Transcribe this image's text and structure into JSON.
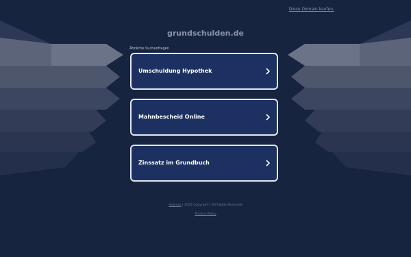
{
  "header": {
    "buy_domain_link": "Diese Domain kaufen."
  },
  "domain": "grundschulden.de",
  "related": {
    "label": "Ähnliche Suchanfragen",
    "items": [
      {
        "label": "Umschuldung Hypothek"
      },
      {
        "label": "Mahnbescheid Online"
      },
      {
        "label": "Zinssatz im Grundbuch"
      }
    ]
  },
  "footer": {
    "impressum": "Impress",
    "copyright": " | 2025 Copyright | All Rights Reserved",
    "privacy": "Privacy Policy"
  },
  "colors": {
    "background": "#172440",
    "card_fill": "#1c3162",
    "card_border": "#e4e8f0",
    "text_muted": "#8b94a6"
  },
  "icons": {
    "card_arrow": "chevron-right-icon"
  }
}
